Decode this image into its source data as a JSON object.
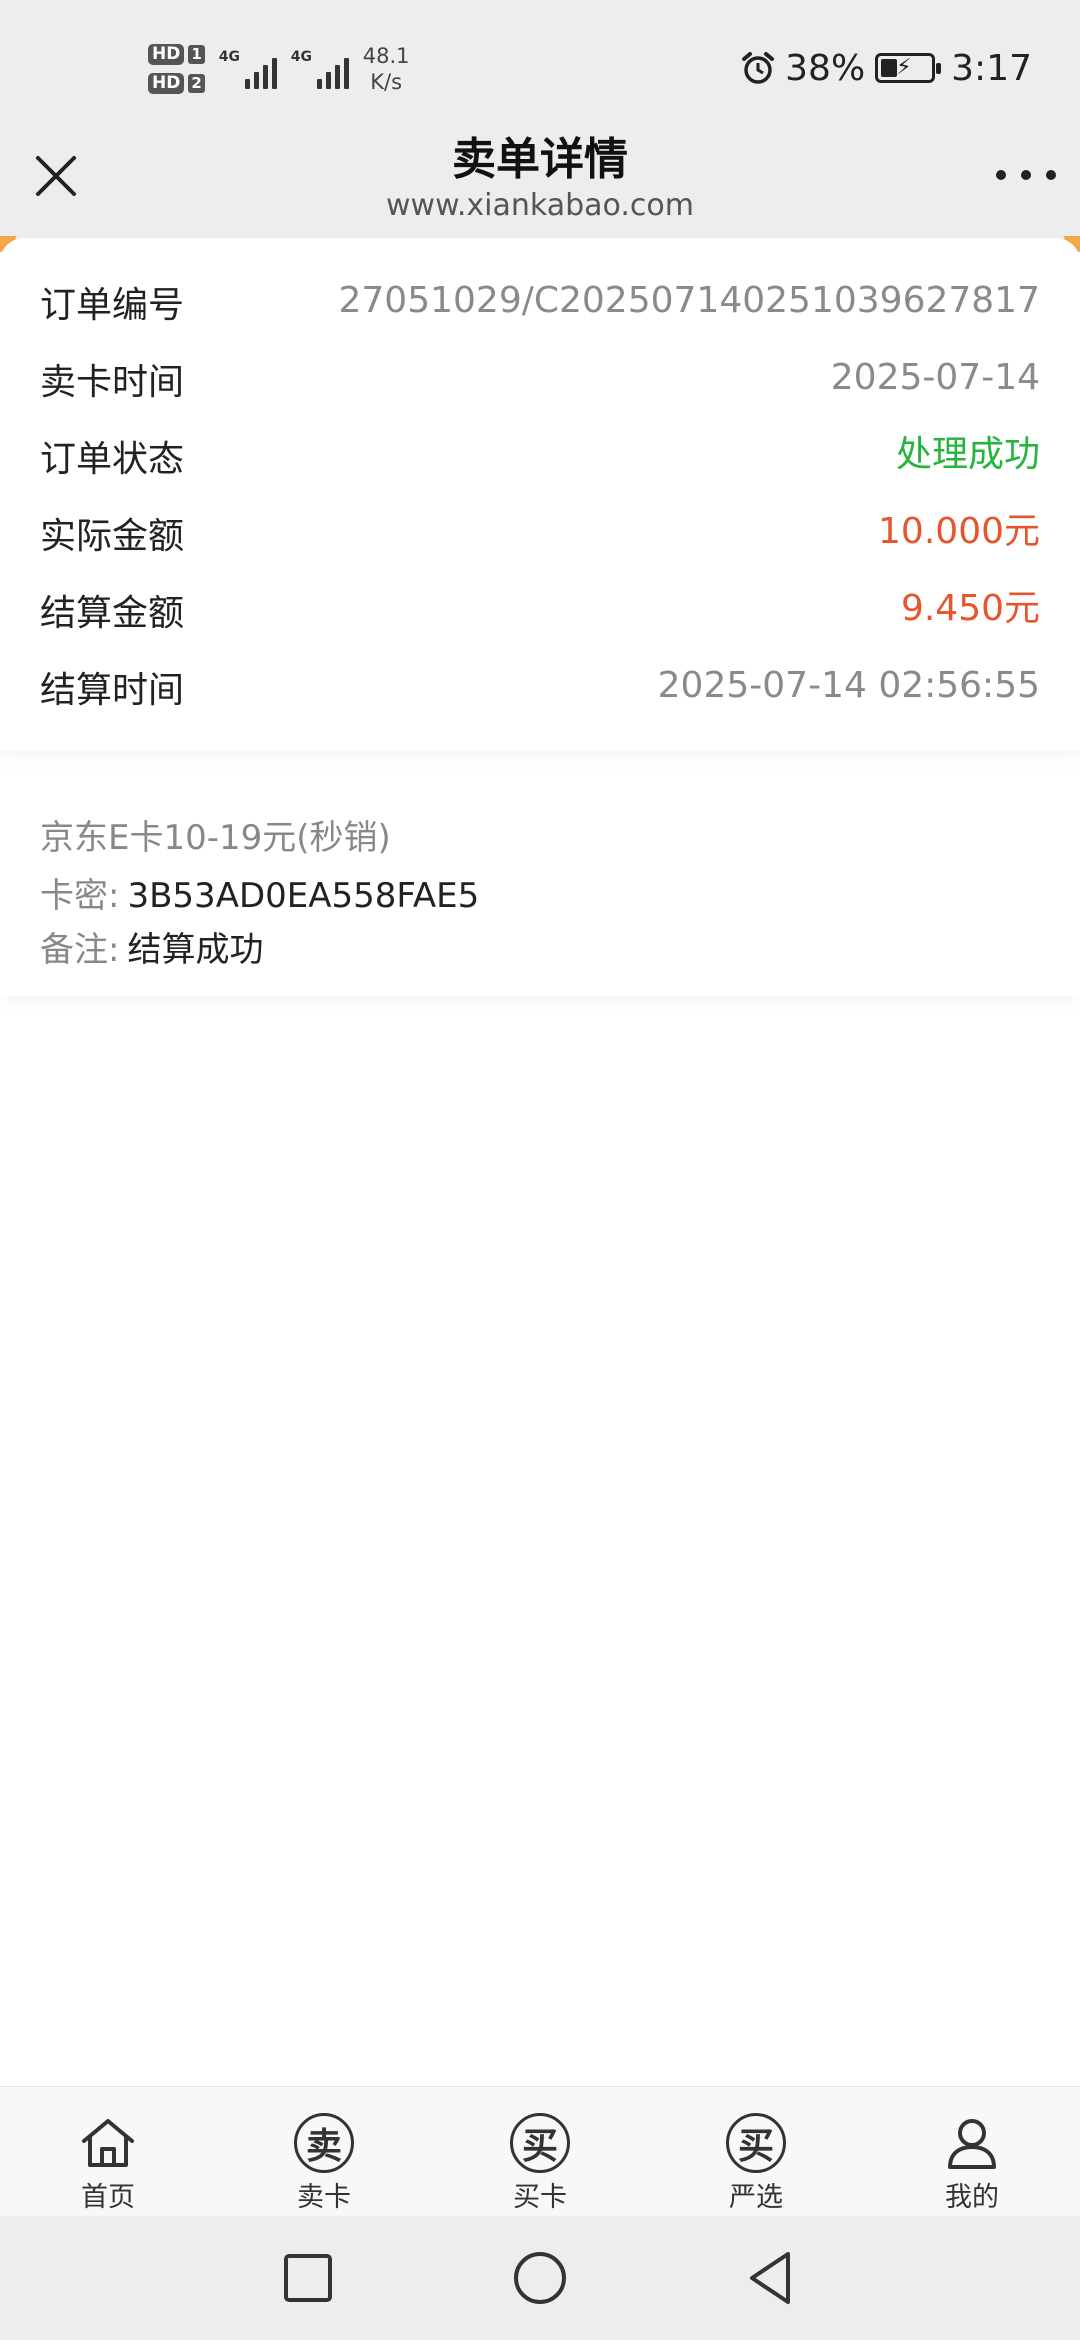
{
  "status_bar": {
    "hd1": "HD",
    "sim1": "1",
    "hd2": "HD",
    "sim2": "2",
    "net1": "4G",
    "net2": "4G",
    "speed_value": "48.1",
    "speed_unit": "K/s",
    "battery_percent": "38%",
    "time": "3:17",
    "icons": [
      "alarm-icon",
      "battery-charging-icon"
    ]
  },
  "header": {
    "title": "卖单详情",
    "url": "www.xiankabao.com",
    "close_icon": "close-icon",
    "more_icon": "more-icon"
  },
  "details": [
    {
      "label": "订单编号",
      "value": "27051029/C2025071402510396278​17"
    },
    {
      "label": "卖卡时间",
      "value": "2025-07-14"
    },
    {
      "label": "订单状态",
      "value": "处理成功",
      "color": "#25b43e"
    },
    {
      "label": "实际金额",
      "value": "10.000元",
      "color": "#e6552b"
    },
    {
      "label": "结算金额",
      "value": "9.450元",
      "color": "#e6552b"
    },
    {
      "label": "结算时间",
      "value": "2025-07-14 02:56:55"
    }
  ],
  "card": {
    "name": "京东E卡10-19元(秒销)",
    "secret_label": "卡密:",
    "secret_value": "3B53AD0EA558FAE5",
    "remark_label": "备注:",
    "remark_value": "结算成功"
  },
  "tabbar": [
    {
      "label": "首页",
      "icon": "home-icon"
    },
    {
      "label": "卖卡",
      "icon": "sell-icon",
      "glyph": "卖"
    },
    {
      "label": "买卡",
      "icon": "buy-icon",
      "glyph": "买"
    },
    {
      "label": "严选",
      "icon": "select-icon",
      "glyph": "买"
    },
    {
      "label": "我的",
      "icon": "profile-icon"
    }
  ],
  "navbar": [
    "recent-apps-icon",
    "home-nav-icon",
    "back-icon"
  ]
}
